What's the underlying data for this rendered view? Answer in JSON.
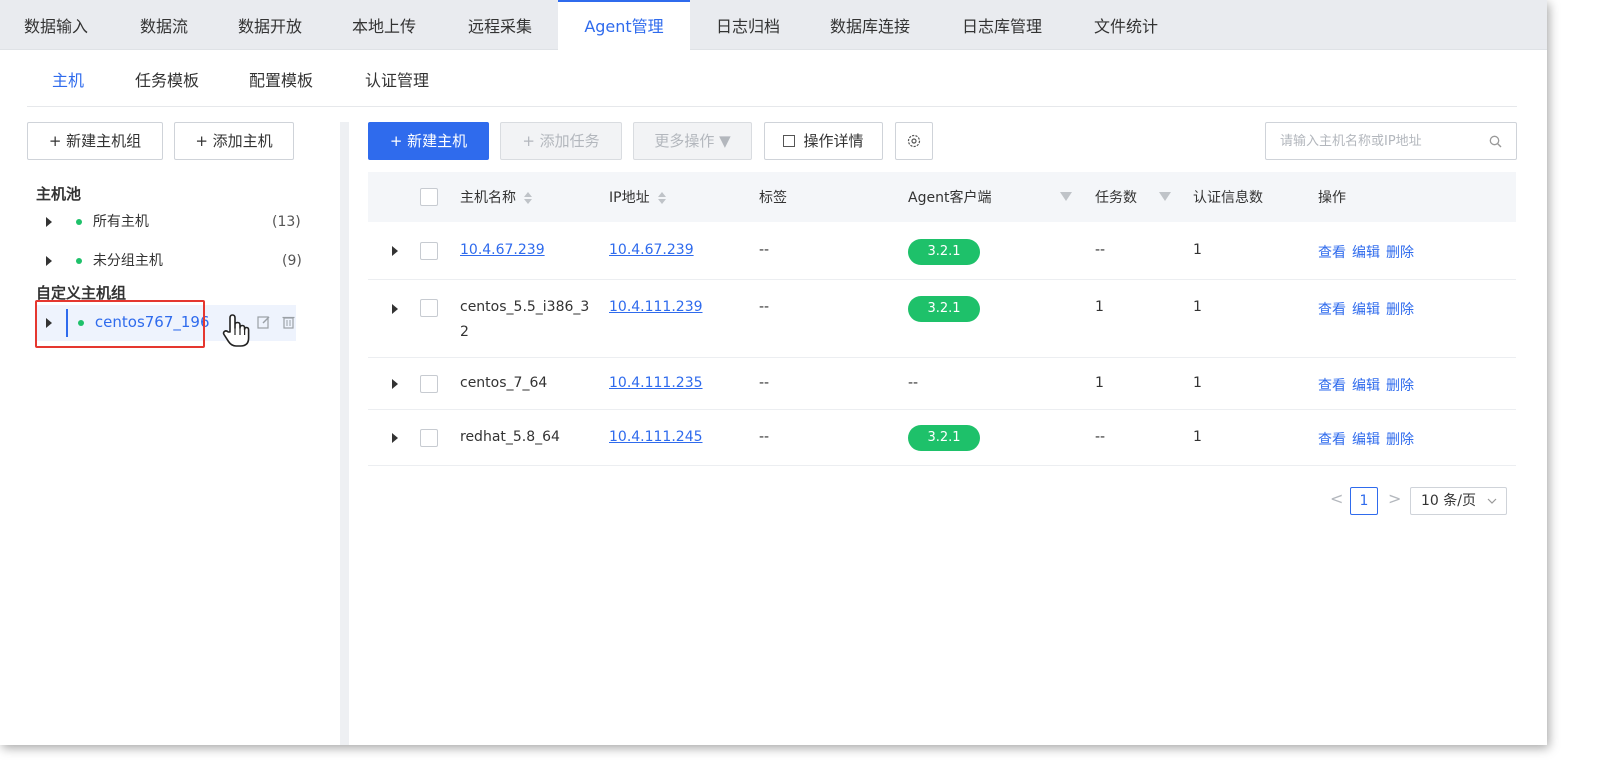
{
  "top_nav": {
    "tabs": [
      {
        "label": "数据输入"
      },
      {
        "label": "数据流"
      },
      {
        "label": "数据开放"
      },
      {
        "label": "本地上传"
      },
      {
        "label": "远程采集"
      },
      {
        "label": "Agent管理"
      },
      {
        "label": "日志归档"
      },
      {
        "label": "数据库连接"
      },
      {
        "label": "日志库管理"
      },
      {
        "label": "文件统计"
      }
    ],
    "active_index": 5
  },
  "sub_nav": {
    "tabs": [
      {
        "label": "主机"
      },
      {
        "label": "任务模板"
      },
      {
        "label": "配置模板"
      },
      {
        "label": "认证管理"
      }
    ],
    "active_index": 0
  },
  "sidebar": {
    "new_group_button": "+ 新建主机组",
    "add_host_button": "+ 添加主机",
    "host_pool_title": "主机池",
    "pool_items": [
      {
        "label": "所有主机",
        "count": "(13)"
      },
      {
        "label": "未分组主机",
        "count": "(9)"
      }
    ],
    "custom_group_title": "自定义主机组",
    "custom_items": [
      {
        "label": "centos767_196"
      }
    ]
  },
  "toolbar": {
    "new_host": "+ 新建主机",
    "add_task": "+ 添加任务",
    "more_actions": "更多操作 ▼",
    "op_details": "操作详情",
    "search_placeholder": "请输入主机名称或IP地址"
  },
  "table": {
    "columns": [
      "主机名称",
      "IP地址",
      "标签",
      "Agent客户端",
      "任务数",
      "认证信息数",
      "操作"
    ],
    "rows": [
      {
        "host_name": "10.4.67.239",
        "host_is_link": true,
        "ip": "10.4.67.239",
        "tag": "--",
        "agent": "3.2.1",
        "tasks": "--",
        "auth": "1"
      },
      {
        "host_name_line1": "centos_5.5_i386_3",
        "host_name_line2": "2",
        "ip": "10.4.111.239",
        "tag": "--",
        "agent": "3.2.1",
        "tasks": "1",
        "auth": "1"
      },
      {
        "host_name": "centos_7_64",
        "ip": "10.4.111.235",
        "tag": "--",
        "agent": "--",
        "tasks": "1",
        "auth": "1"
      },
      {
        "host_name": "redhat_5.8_64",
        "ip": "10.4.111.245",
        "tag": "--",
        "agent": "3.2.1",
        "tasks": "--",
        "auth": "1"
      }
    ],
    "actions": {
      "view": "查看",
      "edit": "编辑",
      "delete": "删除"
    }
  },
  "pagination": {
    "prev": "<",
    "current_page": "1",
    "next": ">",
    "page_size": "10 条/页"
  },
  "colors": {
    "accent": "#2f6bed",
    "success": "#1ec16a",
    "highlight_border": "#e5372f"
  }
}
